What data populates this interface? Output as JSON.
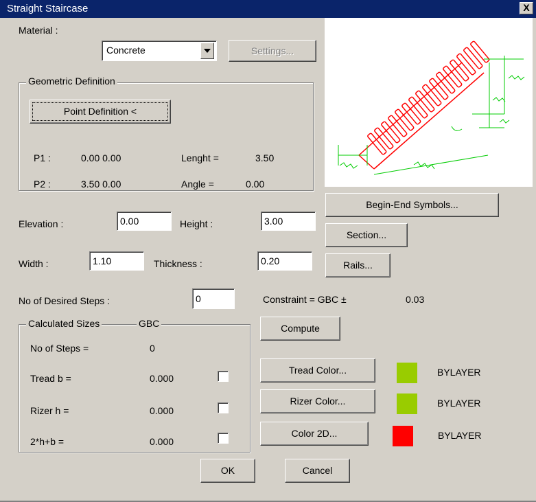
{
  "window": {
    "title": "Straight Staircase",
    "close_glyph": "X"
  },
  "material": {
    "label": "Material :",
    "selected": "Concrete",
    "settings_label": "Settings..."
  },
  "geometric": {
    "group_label": "Geometric Definition",
    "point_button": "Point Definition <",
    "p1_label": "P1 :",
    "p1_value": "0.00 0.00",
    "length_label": "Lenght =",
    "length_value": "3.50",
    "p2_label": "P2 :",
    "p2_value": "3.50 0.00",
    "angle_label": "Angle =",
    "angle_value": "0.00"
  },
  "params": {
    "elevation_label": "Elevation :",
    "elevation_value": "0.00",
    "height_label": "Height :",
    "height_value": "3.00",
    "width_label": "Width :",
    "width_value": "1.10",
    "thickness_label": "Thickness :",
    "thickness_value": "0.20"
  },
  "buttons": {
    "begin_end": "Begin-End Symbols...",
    "section": "Section...",
    "rails": "Rails...",
    "compute": "Compute",
    "tread_color": "Tread Color...",
    "rizer_color": "Rizer Color...",
    "color2d": "Color 2D...",
    "ok": "OK",
    "cancel": "Cancel"
  },
  "steps": {
    "desired_label": "No of Desired Steps :",
    "desired_value": "0"
  },
  "constraint": {
    "label": "Constraint = GBC ±",
    "value": "0.03"
  },
  "calculated": {
    "group_label": "Calculated Sizes",
    "group_std": "GBC",
    "steps_label": "No of Steps =",
    "steps_value": "0",
    "tread_label": "Tread b =",
    "tread_value": "0.000",
    "rizer_label": "Rizer h =",
    "rizer_value": "0.000",
    "formula_label": "2*h+b =",
    "formula_value": "0.000"
  },
  "colors": {
    "tread_text": "BYLAYER",
    "tread_swatch": "#99cc00",
    "rizer_text": "BYLAYER",
    "rizer_swatch": "#99cc00",
    "color2d_text": "BYLAYER",
    "color2d_swatch": "#ff0000"
  },
  "theme": {
    "titlebar": "#0a246a",
    "face": "#d4d0c8",
    "stair_red": "#ff0000",
    "dim_green": "#00cc00"
  },
  "icons": {
    "dropdown": "chevron-down-icon",
    "close": "close-icon"
  }
}
